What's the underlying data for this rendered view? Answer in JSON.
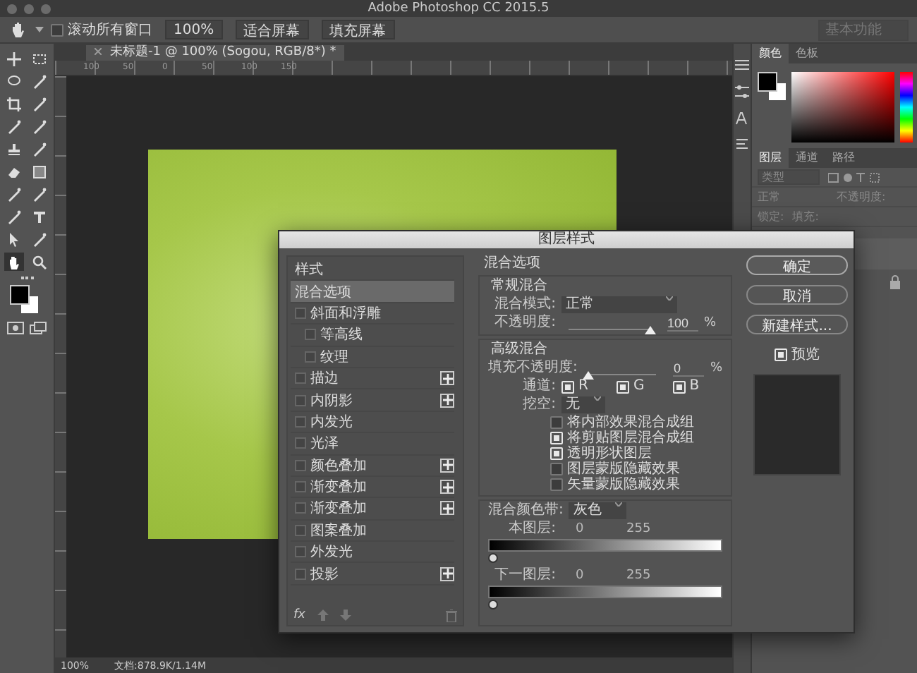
{
  "window": {
    "title": "Adobe Photoshop CC 2015.5"
  },
  "options_bar": {
    "scroll_all": {
      "label": "滚动所有窗口",
      "checked": false
    },
    "buttons": [
      "100%",
      "适合屏幕",
      "填充屏幕"
    ],
    "workspace": "基本功能"
  },
  "document_tab": {
    "title": "未标题-1 @ 100% (Sogou, RGB/8*) *"
  },
  "ruler": {
    "top_labels": [
      "100",
      "50",
      "0",
      "50",
      "100",
      "150"
    ]
  },
  "color_panel": {
    "tabs": [
      {
        "label": "颜色",
        "selected": true
      },
      {
        "label": "色板",
        "selected": false
      }
    ]
  },
  "layers_panel": {
    "tabs": [
      {
        "label": "图层",
        "selected": true
      },
      {
        "label": "通道",
        "selected": false
      },
      {
        "label": "路径",
        "selected": false
      }
    ],
    "filter_placeholder": "类型",
    "blend_mode": "正常",
    "opacity_label": "不透明度:",
    "lock_label": "锁定:",
    "fill_label": "填充:"
  },
  "dialog": {
    "title": "图层样式",
    "styles": [
      {
        "kind": "header",
        "label": "样式",
        "selected": false
      },
      {
        "kind": "option",
        "label": "混合选项",
        "selected": true
      },
      {
        "kind": "effect",
        "label": "斜面和浮雕",
        "selected": false,
        "checked": false,
        "plus": false,
        "children": [
          {
            "kind": "effect",
            "label": "等高线",
            "selected": false,
            "checked": false,
            "plus": false
          },
          {
            "kind": "effect",
            "label": "纹理",
            "selected": false,
            "checked": false,
            "plus": false
          }
        ]
      },
      {
        "kind": "effect",
        "label": "描边",
        "selected": false,
        "checked": false,
        "plus": true
      },
      {
        "kind": "effect",
        "label": "内阴影",
        "selected": false,
        "checked": false,
        "plus": true
      },
      {
        "kind": "effect",
        "label": "内发光",
        "selected": false,
        "checked": false,
        "plus": false
      },
      {
        "kind": "effect",
        "label": "光泽",
        "selected": false,
        "checked": false,
        "plus": false
      },
      {
        "kind": "effect",
        "label": "颜色叠加",
        "selected": false,
        "checked": false,
        "plus": true
      },
      {
        "kind": "effect",
        "label": "渐变叠加",
        "selected": false,
        "checked": false,
        "plus": true
      },
      {
        "kind": "effect",
        "label": "渐变叠加",
        "selected": false,
        "checked": false,
        "plus": true
      },
      {
        "kind": "effect",
        "label": "图案叠加",
        "selected": false,
        "checked": false,
        "plus": false
      },
      {
        "kind": "effect",
        "label": "外发光",
        "selected": false,
        "checked": false,
        "plus": false
      },
      {
        "kind": "effect",
        "label": "投影",
        "selected": false,
        "checked": false,
        "plus": true
      }
    ],
    "fx_label": "fx",
    "blending": {
      "heading": "混合选项",
      "general": {
        "heading": "常规混合",
        "mode_label": "混合模式:",
        "mode": "正常",
        "opacity_label": "不透明度:",
        "opacity": {
          "level": 1,
          "value": "100",
          "unit": "%"
        }
      },
      "advanced": {
        "heading": "高级混合",
        "fill_label": "填充不透明度:",
        "fill": {
          "level": 0,
          "value": "0",
          "unit": "%"
        },
        "channels_label": "通道:",
        "channels": [
          {
            "label": "R",
            "checked": true
          },
          {
            "label": "G",
            "checked": true
          },
          {
            "label": "B",
            "checked": true
          }
        ],
        "knockout_label": "挖空:",
        "knockout": "无",
        "options": [
          {
            "label": "将内部效果混合成组",
            "checked": false
          },
          {
            "label": "将剪贴图层混合成组",
            "checked": true
          },
          {
            "label": "透明形状图层",
            "checked": true
          },
          {
            "label": "图层蒙版隐藏效果",
            "checked": false
          },
          {
            "label": "矢量蒙版隐藏效果",
            "checked": false
          }
        ]
      },
      "blend_if": {
        "label": "混合颜色带:",
        "value": "灰色",
        "bands": [
          {
            "label": "本图层:",
            "low": "0",
            "high": "255"
          },
          {
            "label": "下一图层:",
            "low": "0",
            "high": "255"
          }
        ]
      }
    },
    "buttons": [
      {
        "label": "确定",
        "default": true
      },
      {
        "label": "取消",
        "default": false
      },
      {
        "label": "新建样式...",
        "default": false
      }
    ],
    "preview": {
      "label": "预览",
      "checked": true
    }
  },
  "status_bar": {
    "zoom": "100%",
    "doc_info": "文档:878.9K/1.14M"
  }
}
